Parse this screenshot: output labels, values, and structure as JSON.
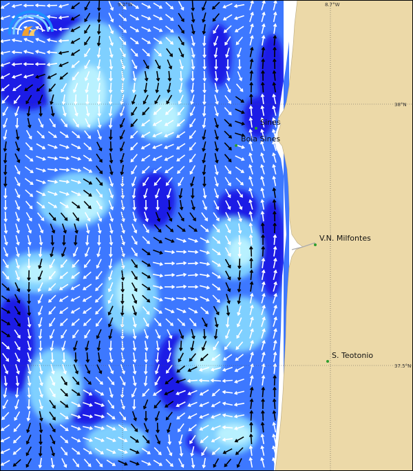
{
  "map": {
    "theme": "sea surface current field off the coast near Sines",
    "colors": {
      "land": "#ecd9a8",
      "shore": "#ffffff",
      "deep": "#1a1ae6",
      "mid": "#3d78ff",
      "light": "#7fd0ff",
      "pale": "#b8f1ff",
      "arrow_fast": "#ffffff",
      "arrow_slow": "#000000",
      "grid": "#555555",
      "place_dot": "#2e9e2e"
    },
    "grid_labels": {
      "lon_left": "9.2°W",
      "lon_right": "8.7°W",
      "lat_top": "38°N",
      "lat_bottom": "37.5°N"
    },
    "places": [
      {
        "name": "Sines"
      },
      {
        "name": "Boia Sines"
      },
      {
        "name": "V.N. Milfontes"
      },
      {
        "name": "S. Teotonio"
      }
    ],
    "logo": {
      "icon": "logo-wave-icon"
    }
  }
}
